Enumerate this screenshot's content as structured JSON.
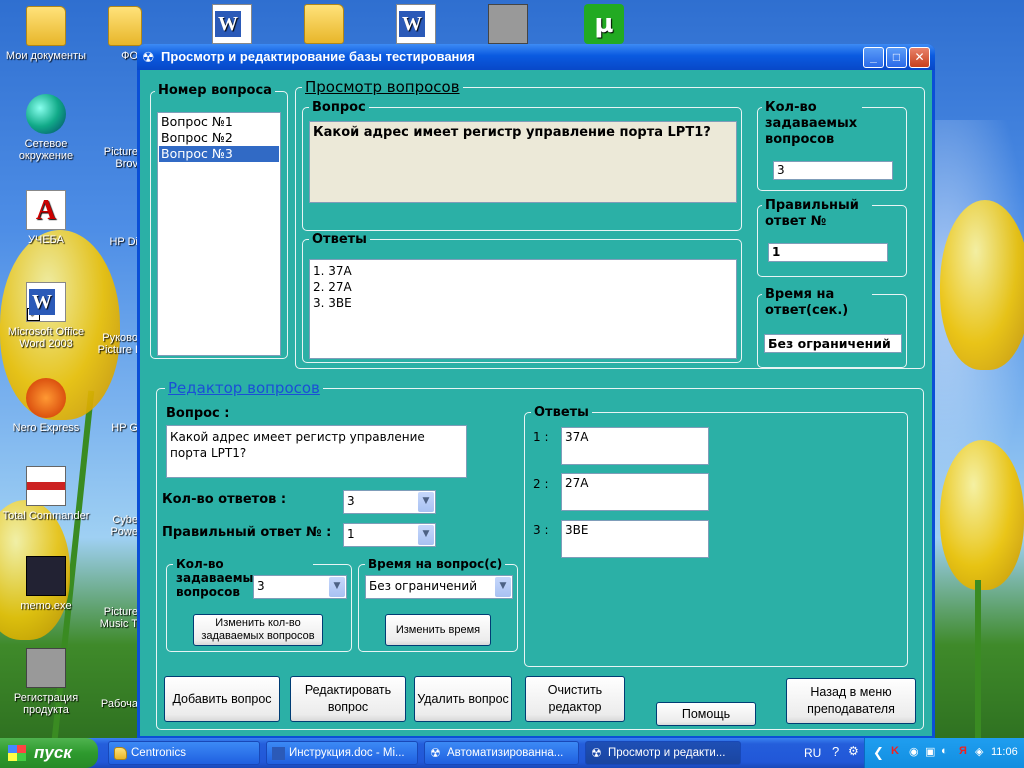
{
  "desktop": {
    "icons": [
      {
        "label": "Мои документы"
      },
      {
        "label": "Сетевое окружение"
      },
      {
        "label": "УЧЕБА"
      },
      {
        "label": "Microsoft Office Word 2003"
      },
      {
        "label": "Nero Express"
      },
      {
        "label": "Total Commander"
      },
      {
        "label": "memo.exe"
      },
      {
        "label": "Регистрация продукта"
      },
      {
        "label": "ФО"
      },
      {
        "label": "Picture Brov"
      },
      {
        "label": "HP Di"
      },
      {
        "label": "Руково Picture I"
      },
      {
        "label": "HP G"
      },
      {
        "label": "Cybe Powe"
      },
      {
        "label": "Picture Music T"
      },
      {
        "label": "Рабоча"
      }
    ]
  },
  "window": {
    "title": "Просмотр и редактирование базы тестирования",
    "view": {
      "title": "Просмотр вопросов",
      "question_number_label": "Номер вопроса",
      "questions": [
        "Вопрос №1",
        "Вопрос №2",
        "Вопрос №3"
      ],
      "question_label": "Вопрос",
      "question_text": "Какой адрес имеет регистр управление порта LPT1?",
      "answers_label": "Ответы",
      "answers": [
        "1. 37A",
        "2. 27A",
        "3. 3BE"
      ],
      "asked_count_label": "Кол-во задаваемых вопросов",
      "asked_count_value": "3",
      "correct_label": "Правильный ответ №",
      "correct_value": "1",
      "time_label": "Время на ответ(сек.)",
      "time_value": "Без ограничений"
    },
    "editor": {
      "title": "Редактор вопросов",
      "question_label": "Вопрос :",
      "question_text": "Какой адрес имеет регистр управление порта LPT1?",
      "answers_count_label": "Кол-во ответов :",
      "answers_count_value": "3",
      "correct_label": "Правильный ответ № :",
      "correct_value": "1",
      "asked_group_label": "Кол-во задаваемых вопросов",
      "asked_value": "3",
      "change_asked_button": "Изменить кол-во задаваемых вопросов",
      "time_group_label": "Время на вопрос(с)",
      "time_value": "Без ограничений",
      "change_time_button": "Изменить время",
      "answers_group_label": "Ответы",
      "answers": [
        {
          "num": "1 :",
          "value": "37A"
        },
        {
          "num": "2 :",
          "value": "27A"
        },
        {
          "num": "3 :",
          "value": "3BE"
        }
      ]
    },
    "buttons": {
      "add": "Добавить вопрос",
      "edit": "Редактировать вопрос",
      "delete": "Удалить вопрос",
      "clear": "Очистить редактор",
      "help": "Помощь",
      "back": "Назад в меню преподавателя"
    }
  },
  "taskbar": {
    "start": "пуск",
    "tasks": [
      "Centronics",
      "Инструкция.doc - Mi...",
      "Автоматизированна...",
      "Просмотр и редакти..."
    ],
    "lang": "RU",
    "clock": "11:06"
  }
}
